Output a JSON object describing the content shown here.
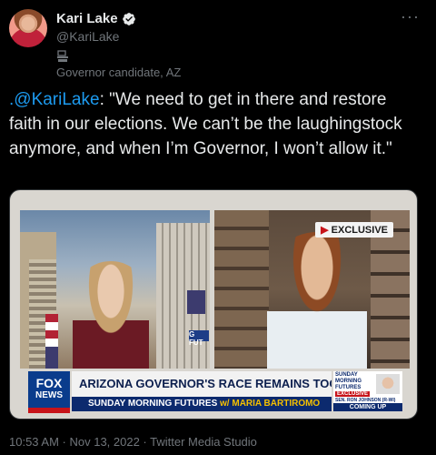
{
  "author": {
    "name": "Kari Lake",
    "handle": "@KariLake",
    "label": "Governor candidate, AZ",
    "verified": true,
    "verified_color": "#1d9bf0"
  },
  "more_label": "···",
  "tweet": {
    "mention": ".@KariLake",
    "body": ": \"We need to get in there and restore faith in our elections. We can’t be the laughingstock anymore, and when I’m Governor, I won’t allow it.\""
  },
  "media": {
    "exclusive_badge": "EXCLUSIVE",
    "network_line1": "FOX",
    "network_line2": "NEWS",
    "headline": "ARIZONA GOVERNOR'S RACE REMAINS TOO CLOSE TO CALL",
    "show": "SUNDAY MORNING FUTURES",
    "host": "w/ MARIA BARTIROMO",
    "promo_title": "SUNDAY MORNING FUTURES",
    "promo_exclusive": "EXCLUSIVE",
    "promo_guest": "SEN. RON JOHNSON (R-WI)",
    "promo_coming": "COMING UP",
    "ticker_fragment": "G FUT"
  },
  "meta": "10:53 AM · Nov 13, 2022 · Twitter Media Studio",
  "colors": {
    "background": "#000000",
    "text": "#e7e9ea",
    "secondary": "#71767b",
    "link": "#1d9bf0",
    "fox_blue": "#0c2a6e",
    "fox_red": "#c7141a"
  }
}
